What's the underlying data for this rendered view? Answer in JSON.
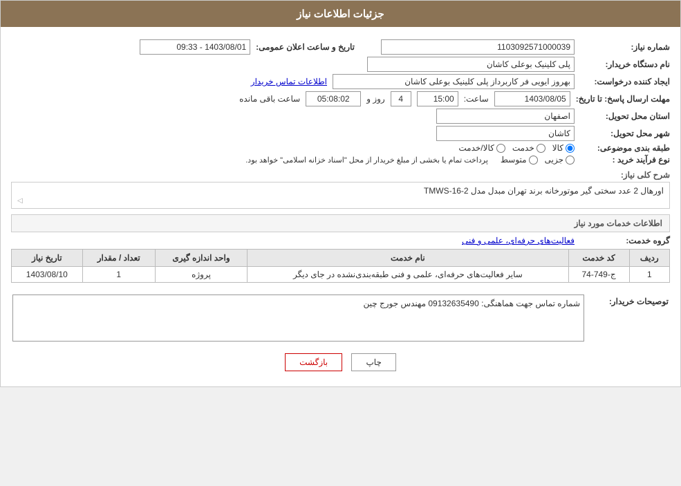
{
  "header": {
    "title": "جزئیات اطلاعات نیاز"
  },
  "form": {
    "need_number_label": "شماره نیاز:",
    "need_number_value": "1103092571000039",
    "buyer_org_label": "نام دستگاه خریدار:",
    "buyer_org_value": "پلی کلینیک بوعلی کاشان",
    "announcement_date_label": "تاریخ و ساعت اعلان عمومی:",
    "announcement_date_value": "1403/08/01 - 09:33",
    "creator_label": "ایجاد کننده درخواست:",
    "creator_value": "بهروز ایویی فر کاربرداز پلی کلینیک بوعلی کاشان",
    "contact_link": "اطلاعات تماس خریدار",
    "deadline_label": "مهلت ارسال پاسخ: تا تاریخ:",
    "deadline_date": "1403/08/05",
    "deadline_time_label": "ساعت:",
    "deadline_time": "15:00",
    "deadline_days_label": "روز و",
    "deadline_days": "4",
    "deadline_remain_label": "ساعت باقی مانده",
    "deadline_remain": "05:08:02",
    "province_label": "استان محل تحویل:",
    "province_value": "اصفهان",
    "city_label": "شهر محل تحویل:",
    "city_value": "کاشان",
    "category_label": "طبقه بندی موضوعی:",
    "category_options": [
      "کالا",
      "خدمت",
      "کالا/خدمت"
    ],
    "category_selected": "کالا",
    "purchase_type_label": "نوع فرآیند خرید :",
    "purchase_type_options": [
      "جزیی",
      "متوسط"
    ],
    "purchase_note": "پرداخت تمام یا بخشی از مبلغ خریدار از محل \"اسناد خزانه اسلامی\" خواهد بود.",
    "need_desc_label": "شرح کلی نیاز:",
    "need_desc_value": "اورهال 2 عدد سختی گیر موتورخانه برند تهران مبدل مدل TMWS-16-2"
  },
  "service_info": {
    "section_title": "اطلاعات خدمات مورد نیاز",
    "service_group_label": "گروه خدمت:",
    "service_group_value": "فعالیت‌های حرفه‌ای، علمی و فنی",
    "table": {
      "headers": [
        "ردیف",
        "کد خدمت",
        "نام خدمت",
        "واحد اندازه گیری",
        "تعداد / مقدار",
        "تاریخ نیاز"
      ],
      "rows": [
        {
          "row": "1",
          "code": "ج-749-74",
          "name": "سایر فعالیت‌های حرفه‌ای، علمی و فنی طبقه‌بندی‌نشده در جای دیگر",
          "unit": "پروژه",
          "qty": "1",
          "date": "1403/08/10"
        }
      ]
    }
  },
  "buyer_notes": {
    "label": "توصیحات خریدار:",
    "value": "شماره تماس جهت هماهنگی: 09132635490 مهندس جورج چین"
  },
  "buttons": {
    "print": "چاپ",
    "back": "بازگشت"
  }
}
